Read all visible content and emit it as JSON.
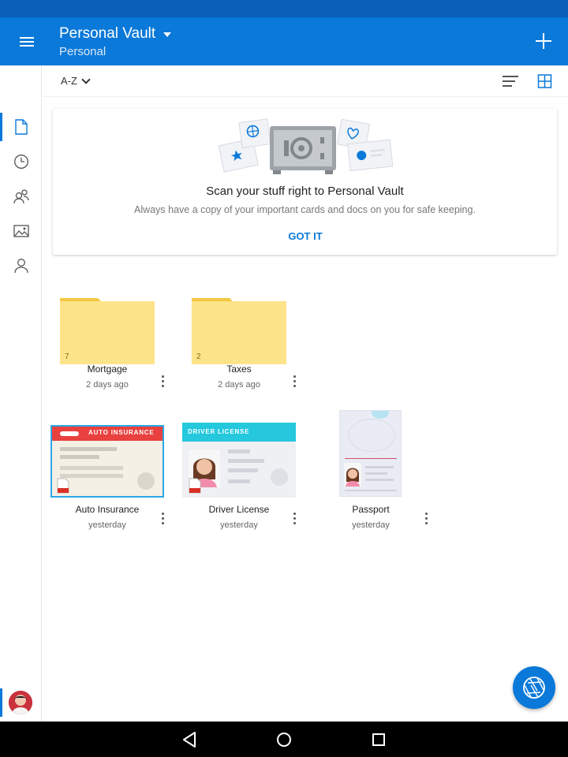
{
  "app_bar": {
    "title": "Personal Vault",
    "subtitle": "Personal",
    "menu_icon": "hamburger-icon",
    "add_icon": "plus-icon"
  },
  "sidebar": {
    "items": [
      {
        "icon": "file-icon",
        "active": true
      },
      {
        "icon": "recent-clock-icon",
        "active": false
      },
      {
        "icon": "shared-people-icon",
        "active": false
      },
      {
        "icon": "photos-icon",
        "active": false
      },
      {
        "icon": "person-icon",
        "active": false
      }
    ]
  },
  "toolbar": {
    "sort_label": "A-Z",
    "list_view_icon": "list-view-icon",
    "grid_view_icon": "grid-view-icon"
  },
  "promo": {
    "title": "Scan your stuff right to Personal Vault",
    "text": "Always have a copy of your important cards and docs on you for safe keeping.",
    "button": "GOT IT"
  },
  "folders": [
    {
      "name": "Mortgage",
      "date": "2 days ago",
      "count": "7"
    },
    {
      "name": "Taxes",
      "date": "2 days ago",
      "count": "2"
    }
  ],
  "files": [
    {
      "name": "Auto Insurance",
      "date": "yesterday",
      "card_label": "AUTO INSURANCE"
    },
    {
      "name": "Driver License",
      "date": "yesterday",
      "card_label": "DRIVER LICENSE"
    },
    {
      "name": "Passport",
      "date": "yesterday"
    }
  ],
  "colors": {
    "accent": "#0a79d9",
    "status_bar": "#0a5fb8",
    "folder": "#fde48a",
    "insurance_red": "#e8413f",
    "license_teal": "#25c8dd"
  },
  "fab_icon": "camera-shutter-icon"
}
